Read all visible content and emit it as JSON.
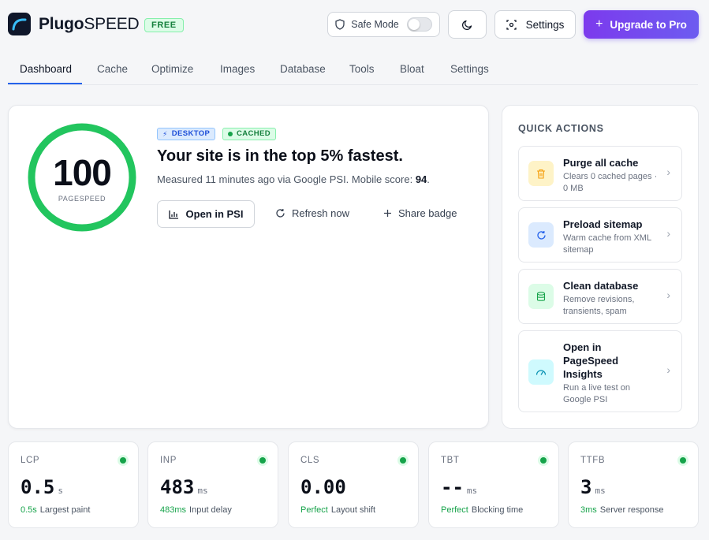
{
  "brand": {
    "name_bold": "Plugo",
    "name_light": "SPEED",
    "plan_badge": "FREE"
  },
  "header": {
    "safe_mode_label": "Safe Mode",
    "safe_mode_on": false,
    "settings_label": "Settings",
    "upgrade_label": "Upgrade to Pro"
  },
  "tabs": [
    {
      "label": "Dashboard",
      "active": true
    },
    {
      "label": "Cache"
    },
    {
      "label": "Optimize"
    },
    {
      "label": "Images"
    },
    {
      "label": "Database"
    },
    {
      "label": "Tools"
    },
    {
      "label": "Bloat"
    },
    {
      "label": "Settings"
    }
  ],
  "score": {
    "value": "100",
    "label": "PAGESPEED",
    "device_badge": "DESKTOP",
    "status_badge": "CACHED",
    "headline": "Your site is in the top 5% fastest.",
    "measured_text": "Measured 11 minutes ago via Google PSI. Mobile score: ",
    "mobile_score": "94",
    "period": ".",
    "open_psi_label": "Open in PSI",
    "refresh_label": "Refresh now",
    "share_label": "Share badge"
  },
  "quick_actions": {
    "title": "QUICK ACTIONS",
    "items": [
      {
        "name": "Purge all cache",
        "desc": "Clears 0 cached pages · 0 MB",
        "icon": "trash-icon",
        "color": "#f59e0b",
        "bg": "#fef3c7"
      },
      {
        "name": "Preload sitemap",
        "desc": "Warm cache from XML sitemap",
        "icon": "refresh-icon",
        "color": "#2563eb",
        "bg": "#dbeafe"
      },
      {
        "name": "Clean database",
        "desc": "Remove revisions, transients, spam",
        "icon": "database-icon",
        "color": "#16a34a",
        "bg": "#dcfce7"
      },
      {
        "name": "Open in PageSpeed Insights",
        "desc": "Run a live test on Google PSI",
        "icon": "gauge-icon",
        "color": "#0891b2",
        "bg": "#cffafe"
      }
    ]
  },
  "metrics": [
    {
      "label": "LCP",
      "value": "0.5",
      "unit": "s",
      "foot_value": "0.5s",
      "foot_text": "Largest paint"
    },
    {
      "label": "INP",
      "value": "483",
      "unit": "ms",
      "foot_value": "483ms",
      "foot_text": "Input delay"
    },
    {
      "label": "CLS",
      "value": "0.00",
      "unit": "",
      "foot_value": "Perfect",
      "foot_text": "Layout shift"
    },
    {
      "label": "TBT",
      "value": "--",
      "unit": "ms",
      "foot_value": "Perfect",
      "foot_text": "Blocking time"
    },
    {
      "label": "TTFB",
      "value": "3",
      "unit": "ms",
      "foot_value": "3ms",
      "foot_text": "Server response"
    }
  ]
}
